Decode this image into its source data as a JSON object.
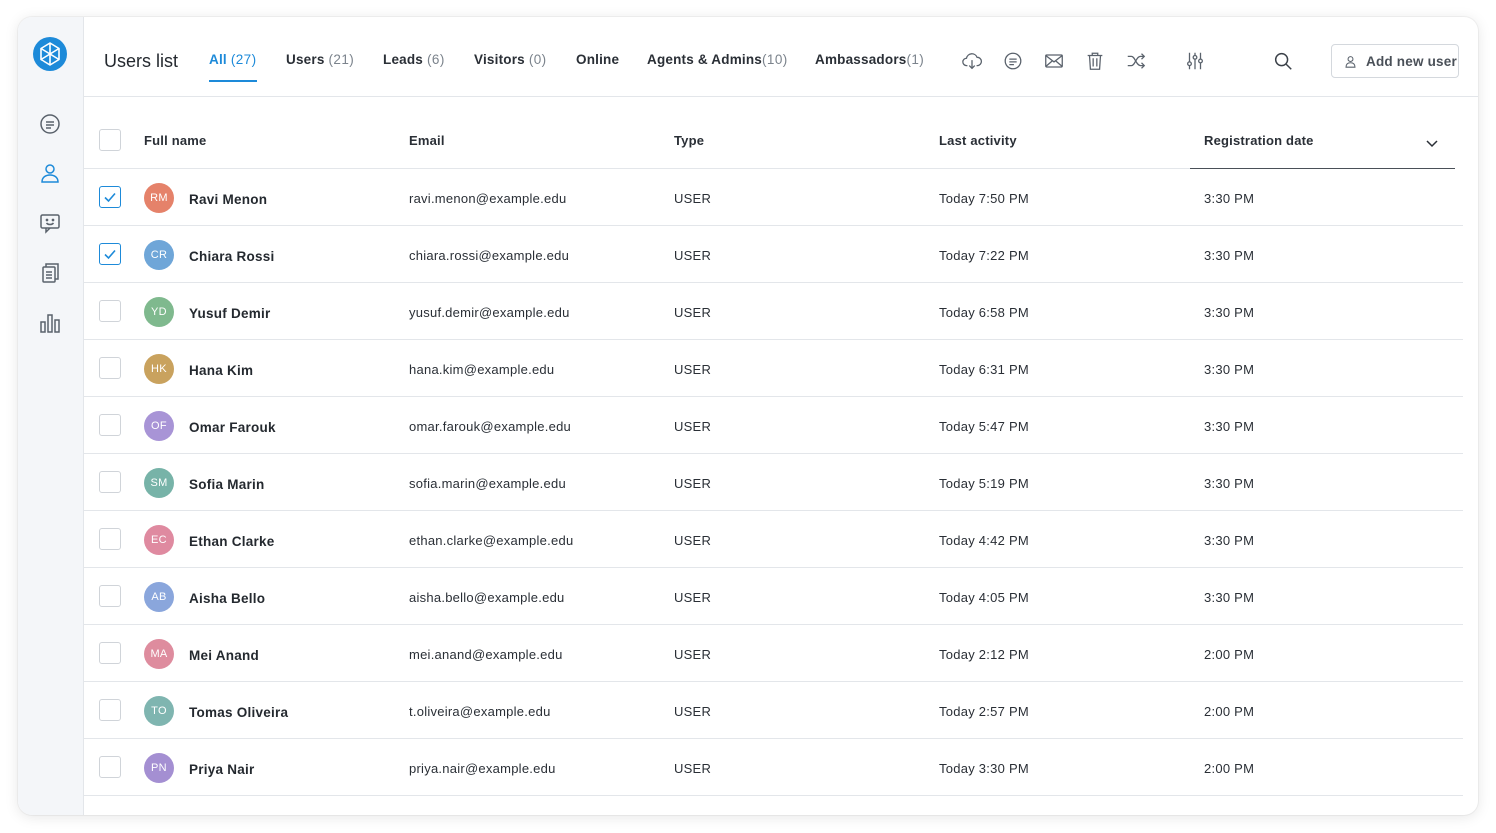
{
  "header": {
    "title": "Users list",
    "add_button": "Add new user"
  },
  "tabs": [
    {
      "label": "All",
      "count": "(27)"
    },
    {
      "label": "Users",
      "count": "(21)"
    },
    {
      "label": "Leads",
      "count": "(6)"
    },
    {
      "label": "Visitors",
      "count": "(0)"
    },
    {
      "label": "Online",
      "count": ""
    },
    {
      "label": "Agents & Admins",
      "count": "(10)"
    },
    {
      "label": "Ambassadors",
      "count": "(1)"
    }
  ],
  "toolbar_icons": [
    "cloud-download-icon",
    "chat-icon",
    "envelope-icon",
    "trash-icon",
    "shuffle-icon",
    "filter-sliders-icon",
    "search-icon"
  ],
  "sidebar_icons": [
    "chat-icon",
    "user-icon",
    "support-chat-icon",
    "documents-icon",
    "bar-chart-icon"
  ],
  "colors": {
    "accent": "#1d8ad9"
  },
  "table": {
    "columns": [
      "Full name",
      "Email",
      "Type",
      "Last activity",
      "Registration date"
    ],
    "rows": [
      {
        "initials": "RM",
        "color": "#e5826a",
        "name": "Ravi Menon",
        "email": "ravi.menon@example.edu",
        "type": "USER",
        "last": "Today 7:50 PM",
        "reg": "3:30 PM",
        "checked": true
      },
      {
        "initials": "CR",
        "color": "#6fa6d8",
        "name": "Chiara Rossi",
        "email": "chiara.rossi@example.edu",
        "type": "USER",
        "last": "Today 7:22 PM",
        "reg": "3:30 PM",
        "checked": true
      },
      {
        "initials": "YD",
        "color": "#7fb98e",
        "name": "Yusuf Demir",
        "email": "yusuf.demir@example.edu",
        "type": "USER",
        "last": "Today 6:58 PM",
        "reg": "3:30 PM",
        "checked": false
      },
      {
        "initials": "HK",
        "color": "#c9a25e",
        "name": "Hana Kim",
        "email": "hana.kim@example.edu",
        "type": "USER",
        "last": "Today 6:31 PM",
        "reg": "3:30 PM",
        "checked": false
      },
      {
        "initials": "OF",
        "color": "#a894d6",
        "name": "Omar Farouk",
        "email": "omar.farouk@example.edu",
        "type": "USER",
        "last": "Today 5:47 PM",
        "reg": "3:30 PM",
        "checked": false
      },
      {
        "initials": "SM",
        "color": "#77b3a8",
        "name": "Sofia Marin",
        "email": "sofia.marin@example.edu",
        "type": "USER",
        "last": "Today 5:19 PM",
        "reg": "3:30 PM",
        "checked": false
      },
      {
        "initials": "EC",
        "color": "#df8aa0",
        "name": "Ethan Clarke",
        "email": "ethan.clarke@example.edu",
        "type": "USER",
        "last": "Today 4:42 PM",
        "reg": "3:30 PM",
        "checked": false
      },
      {
        "initials": "AB",
        "color": "#8aa6dc",
        "name": "Aisha Bello",
        "email": "aisha.bello@example.edu",
        "type": "USER",
        "last": "Today 4:05 PM",
        "reg": "3:30 PM",
        "checked": false
      },
      {
        "initials": "MA",
        "color": "#de8c9e",
        "name": "Mei Anand",
        "email": "mei.anand@example.edu",
        "type": "USER",
        "last": "Today 2:12 PM",
        "reg": "2:00 PM",
        "checked": false
      },
      {
        "initials": "TO",
        "color": "#7fb5b0",
        "name": "Tomas Oliveira",
        "email": "t.oliveira@example.edu",
        "type": "USER",
        "last": "Today 2:57 PM",
        "reg": "2:00 PM",
        "checked": false
      },
      {
        "initials": "PN",
        "color": "#a48fd2",
        "name": "Priya Nair",
        "email": "priya.nair@example.edu",
        "type": "USER",
        "last": "Today 3:30 PM",
        "reg": "2:00 PM",
        "checked": false
      }
    ]
  }
}
